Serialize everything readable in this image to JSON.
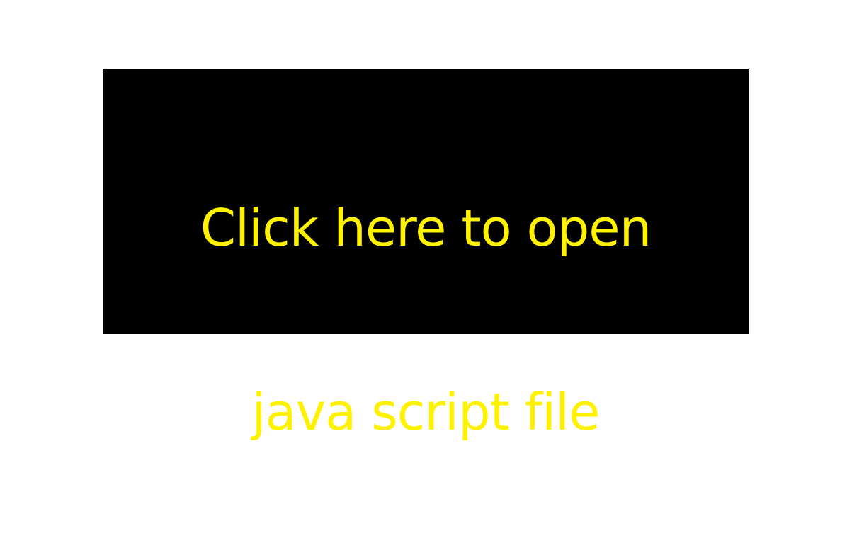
{
  "button": {
    "line1": "Click here to open",
    "line2": "java script file"
  },
  "colors": {
    "page_background": "#ffffff",
    "button_background": "#000000",
    "button_text": "#FFF200"
  }
}
